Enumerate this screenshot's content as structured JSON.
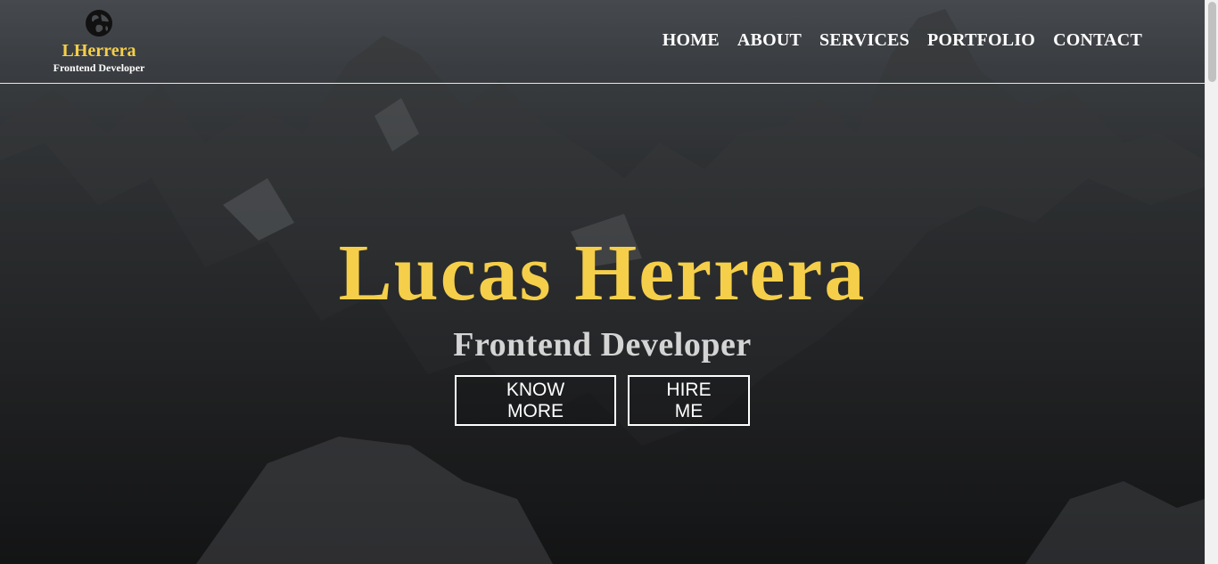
{
  "header": {
    "logo_icon": "globe-icon",
    "brand": "LHerrera",
    "role": "Frontend Developer"
  },
  "nav": {
    "items": [
      {
        "label": "HOME"
      },
      {
        "label": "ABOUT"
      },
      {
        "label": "SERVICES"
      },
      {
        "label": "PORTFOLIO"
      },
      {
        "label": "CONTACT"
      }
    ]
  },
  "hero": {
    "title": "Lucas Herrera",
    "subtitle": "Frontend Developer",
    "know_more_label": "KNOW MORE",
    "hire_me_label": "HIRE ME"
  },
  "colors": {
    "accent": "#f5cf4a",
    "text": "#ffffff",
    "subtitle": "#d4d4d4"
  }
}
